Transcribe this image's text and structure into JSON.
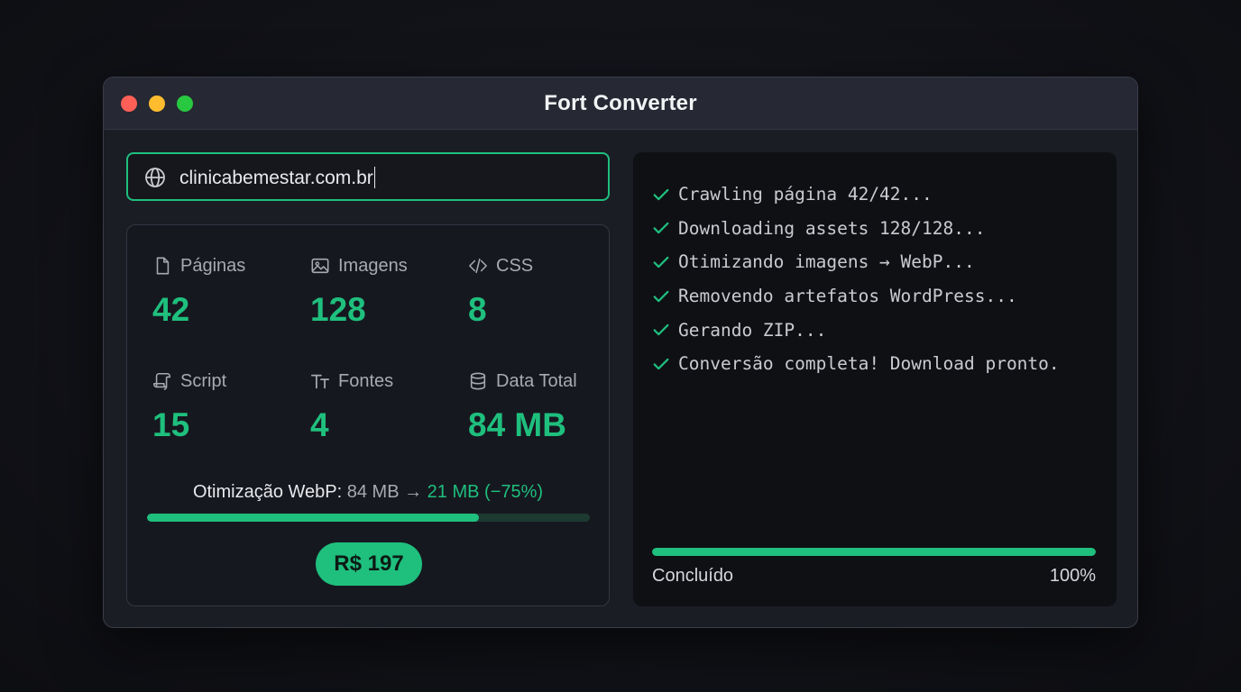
{
  "window": {
    "title": "Fort Converter",
    "traffic_lights": [
      "close",
      "minimize",
      "zoom"
    ]
  },
  "url_input": {
    "value": "clinicabemestar.com.br",
    "icon": "globe-icon"
  },
  "stats": [
    {
      "icon": "file-icon",
      "label": "Páginas",
      "value": "42"
    },
    {
      "icon": "image-icon",
      "label": "Imagens",
      "value": "128"
    },
    {
      "icon": "code-icon",
      "label": "CSS",
      "value": "8"
    },
    {
      "icon": "script-icon",
      "label": "Script",
      "value": "15"
    },
    {
      "icon": "font-icon",
      "label": "Fontes",
      "value": "4"
    },
    {
      "icon": "database-icon",
      "label": "Data Total",
      "value": "84 MB"
    }
  ],
  "optimization": {
    "label": "Otimização WebP:",
    "from": "84 MB →",
    "to": "21 MB (−75%)",
    "progress": 0.75
  },
  "price_button": {
    "label": "R$ 197"
  },
  "log": [
    "Crawling página 42/42...",
    "Downloading assets 128/128...",
    "Otimizando imagens → WebP...",
    "Removendo artefatos WordPress...",
    "Gerando ZIP...",
    "Conversão completa! Download pronto."
  ],
  "completion": {
    "label": "Concluído",
    "percent_text": "100%",
    "progress": 1.0
  },
  "colors": {
    "accent": "#1fbf7e",
    "window_bg": "#1b1d25",
    "titlebar_bg": "#262833",
    "console_bg": "#0f1014",
    "close": "#ff5f57",
    "minimize": "#febc2e",
    "zoom": "#28c840"
  }
}
